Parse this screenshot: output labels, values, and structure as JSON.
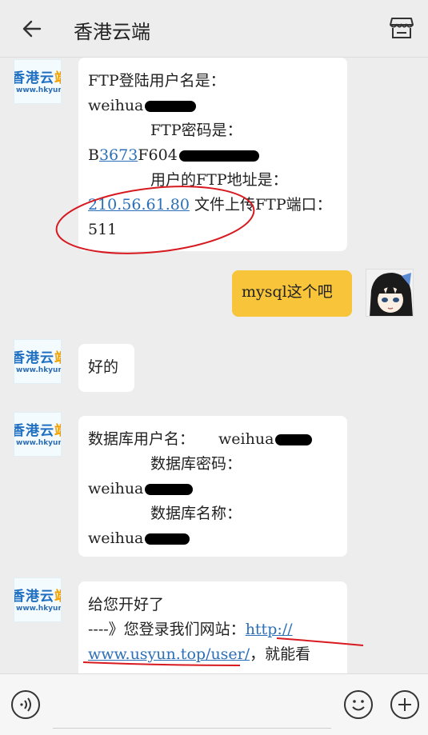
{
  "header": {
    "title": "香港云端",
    "back_icon": "arrow-left-icon",
    "menu_icon": "store-icon"
  },
  "contact_avatar": {
    "logo_main": "香港云",
    "logo_accent": "端",
    "logo_url": "www.hkyun.tc"
  },
  "messages": [
    {
      "sender": "contact",
      "ftp_user_label": "FTP登陆用户名是：",
      "ftp_user_value": "weihua",
      "ftp_pass_label": "FTP密码是：",
      "ftp_pass_prefix": "B",
      "ftp_pass_link": "3673",
      "ftp_pass_suffix": "F604",
      "ftp_addr_label": "用户的FTP地址是：",
      "ftp_addr_link": "210.56.61.80",
      "ftp_addr_text": " 文件上传FTP端口：511"
    },
    {
      "sender": "me",
      "text": "mysql这个吧"
    },
    {
      "sender": "contact",
      "text": "好的"
    },
    {
      "sender": "contact",
      "db_user_label": "数据库用户名：",
      "db_user_value": "weihua",
      "db_pass_label": "数据库密码：",
      "db_pass_value": "weihua",
      "db_name_label": "数据库名称：",
      "db_name_value": "weihua"
    },
    {
      "sender": "contact",
      "greeting": "给您开好了",
      "line2_prefix": "----》您登录我们网站：",
      "line2_link_a": "http://",
      "line2_link_b": "www.usyun.top/user/",
      "line2_suffix": "，就能看"
    }
  ],
  "footer": {
    "voice_icon": "voice-icon",
    "emoji_icon": "emoji-icon",
    "plus_icon": "plus-icon"
  },
  "colors": {
    "background": "#ededed",
    "bubble_contact": "#ffffff",
    "bubble_me": "#f7c43a",
    "link": "#2a6fb7",
    "ink": "#d71920"
  }
}
